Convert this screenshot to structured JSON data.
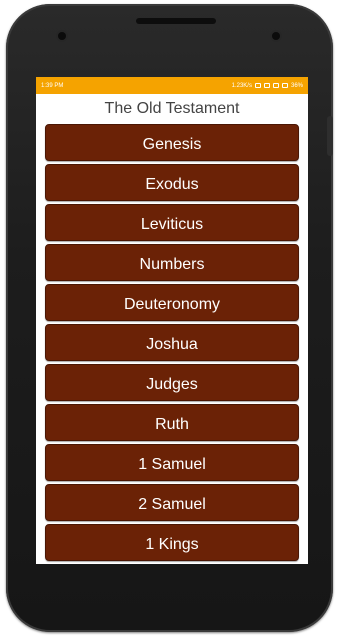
{
  "status_bar": {
    "time": "1:39 PM",
    "speed": "1.23K/s",
    "battery": "36%",
    "color": "#f5a300"
  },
  "app": {
    "title": "The Old Testament"
  },
  "books": [
    {
      "label": "Genesis"
    },
    {
      "label": "Exodus"
    },
    {
      "label": "Leviticus"
    },
    {
      "label": "Numbers"
    },
    {
      "label": "Deuteronomy"
    },
    {
      "label": "Joshua"
    },
    {
      "label": "Judges"
    },
    {
      "label": "Ruth"
    },
    {
      "label": "1 Samuel"
    },
    {
      "label": "2 Samuel"
    },
    {
      "label": "1 Kings"
    }
  ],
  "colors": {
    "button_bg": "#6b2206",
    "button_text": "#ffffff"
  }
}
